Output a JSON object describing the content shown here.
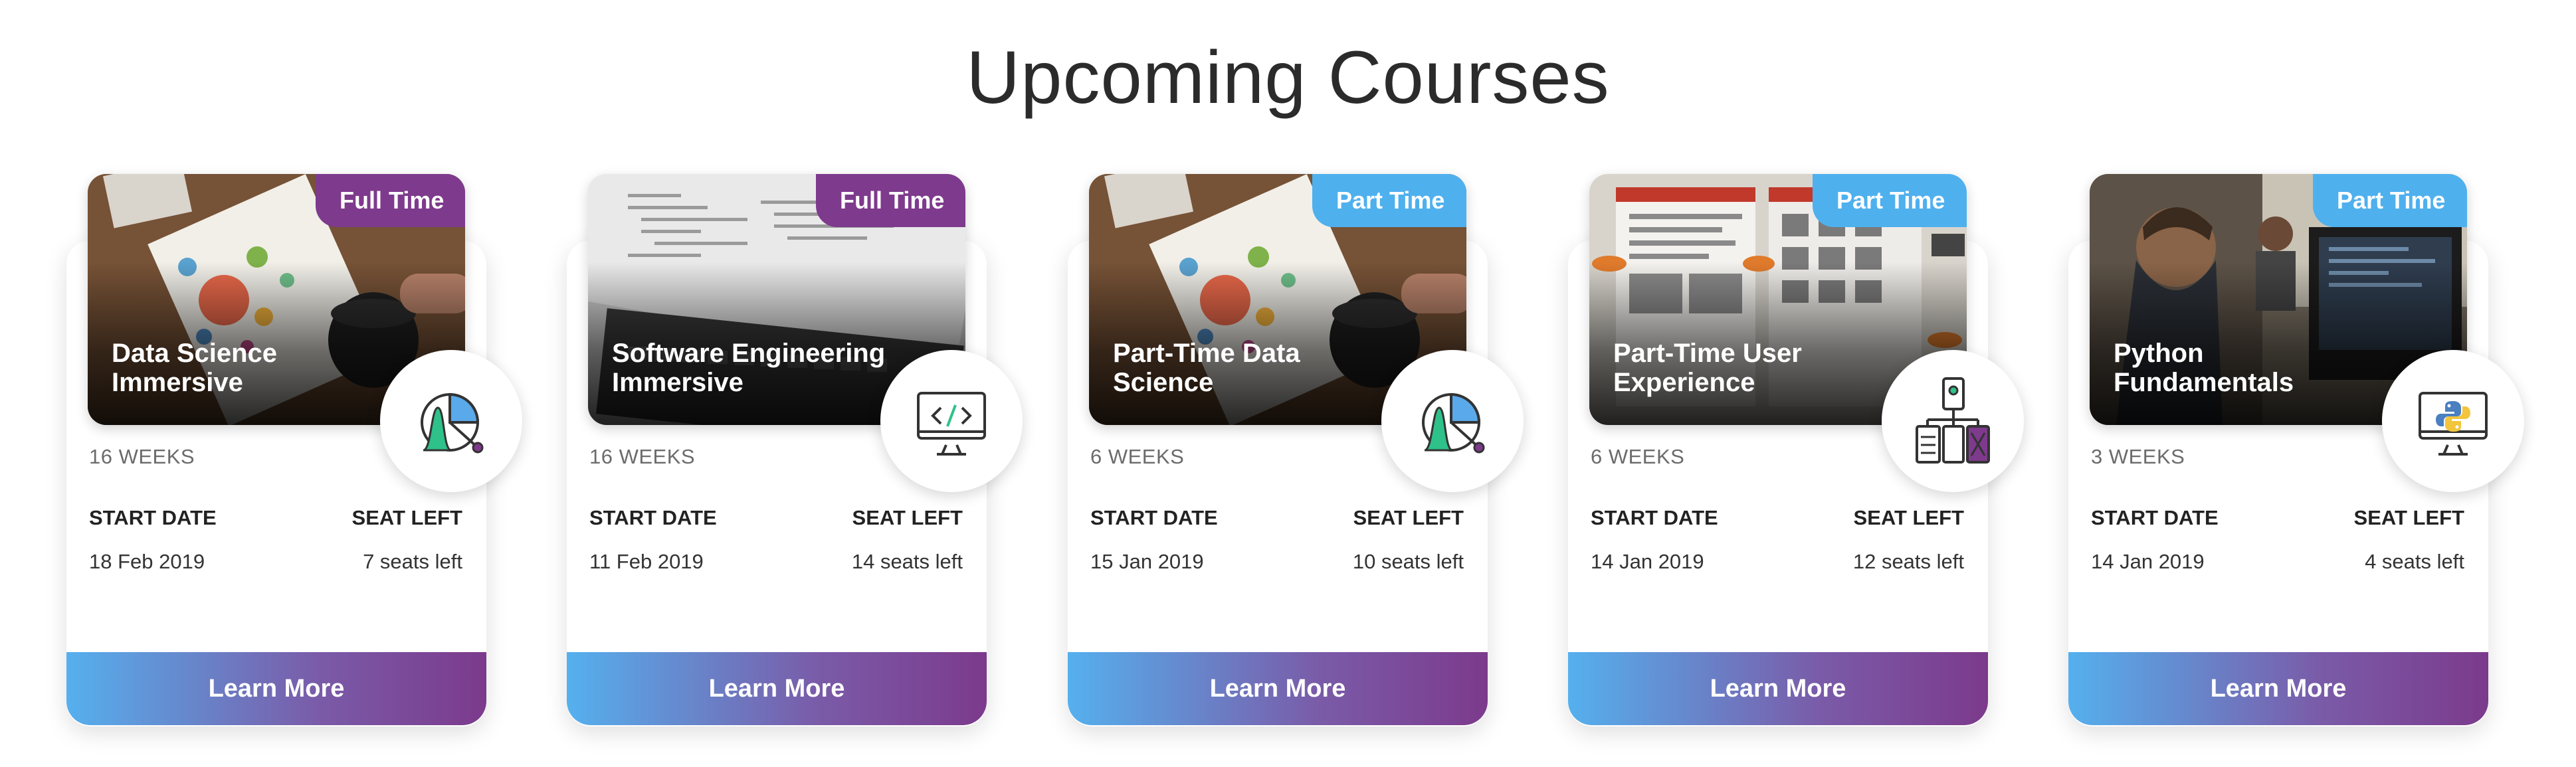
{
  "page": {
    "title": "Upcoming Courses"
  },
  "labels": {
    "start_date": "START DATE",
    "seat_left": "SEAT LEFT",
    "learn_more": "Learn More"
  },
  "colors": {
    "full_time_badge": "#7e3a8c",
    "part_time_badge": "#4fb0ee",
    "button_gradient_start": "#55b0ee",
    "button_gradient_end": "#7c3a8c"
  },
  "courses": [
    {
      "title": "Data Science Immersive",
      "type": "Full Time",
      "duration": "16 WEEKS",
      "start_date": "18 Feb 2019",
      "seats": "7 seats left",
      "icon": "data-chart-icon"
    },
    {
      "title": "Software Engineering Immersive",
      "type": "Full Time",
      "duration": "16 WEEKS",
      "start_date": "11 Feb 2019",
      "seats": "14 seats left",
      "icon": "code-monitor-icon"
    },
    {
      "title": "Part-Time Data Science",
      "type": "Part Time",
      "duration": "6 WEEKS",
      "start_date": "15 Jan 2019",
      "seats": "10 seats left",
      "icon": "data-chart-icon"
    },
    {
      "title": "Part-Time User Experience",
      "type": "Part Time",
      "duration": "6 WEEKS",
      "start_date": "14 Jan 2019",
      "seats": "12 seats left",
      "icon": "ux-wireframe-icon"
    },
    {
      "title": "Python Fundamentals",
      "type": "Part Time",
      "duration": "3 WEEKS",
      "start_date": "14 Jan 2019",
      "seats": "4 seats left",
      "icon": "python-monitor-icon"
    }
  ]
}
